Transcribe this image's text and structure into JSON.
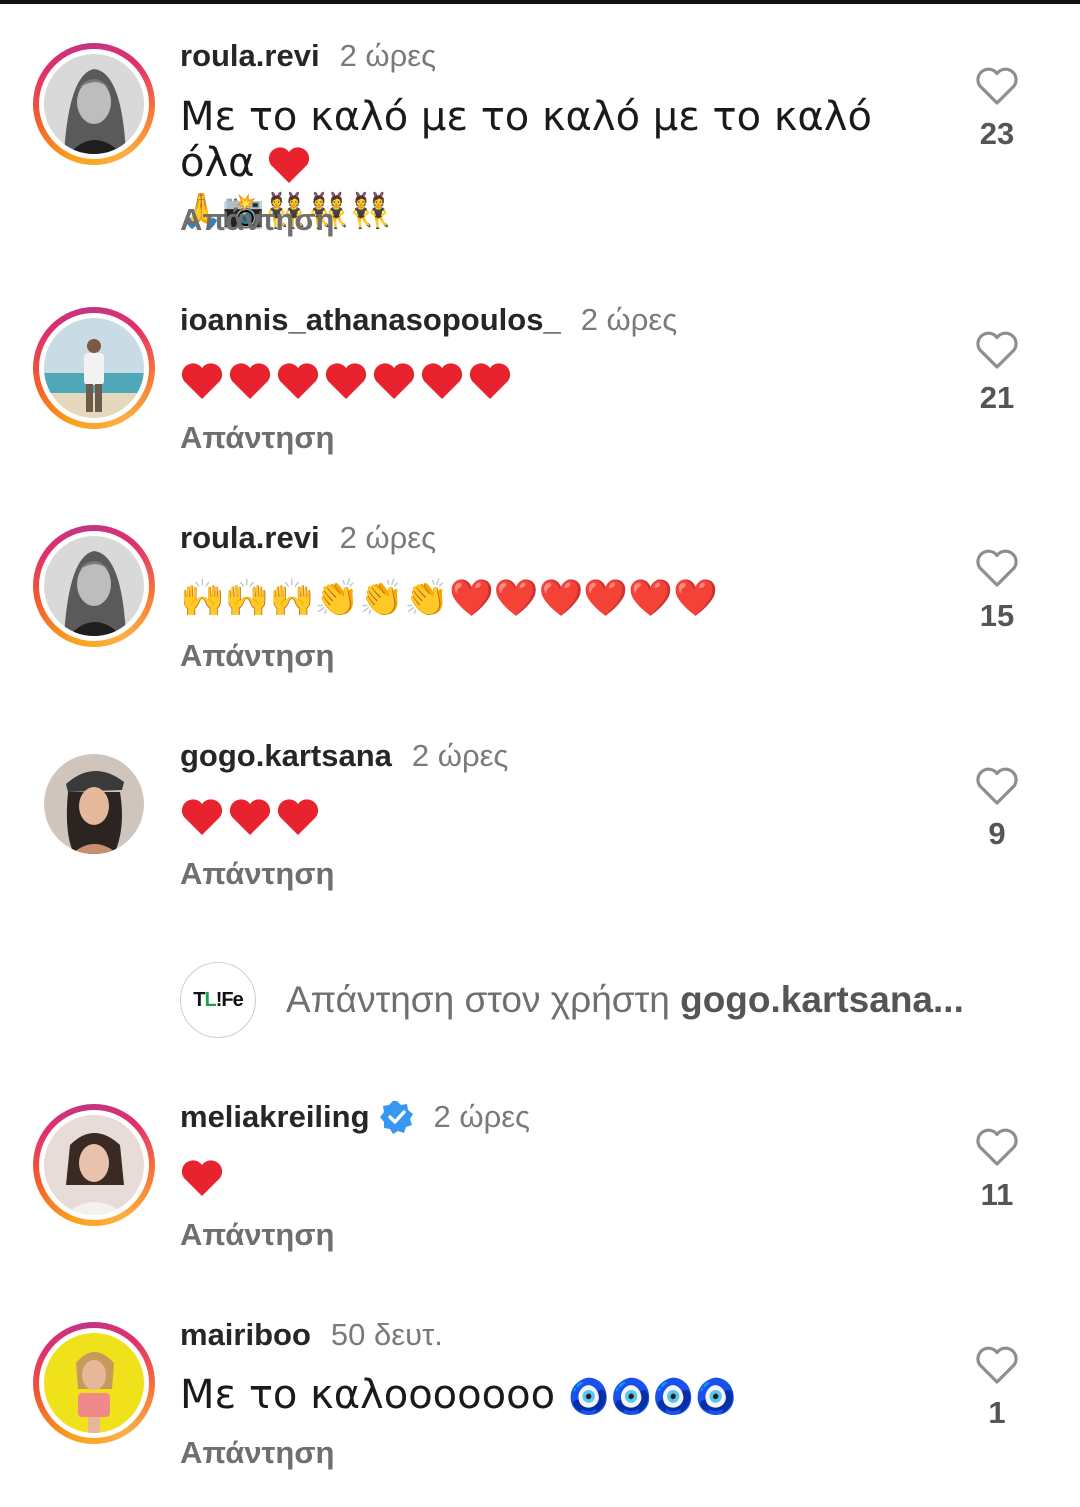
{
  "comments": [
    {
      "username": "roula.revi",
      "time": "2 ώρες",
      "text": "Με το καλό με το καλό με το καλό όλα",
      "emoji_line": "🙏📸👯👯👯",
      "reply_label": "Απάντηση",
      "likes": "23",
      "avatar": "woman-bw-portrait"
    },
    {
      "username": "ioannis_athanasopoulos_",
      "time": "2 ώρες",
      "emoji_line": "❤️❤️❤️❤️❤️❤️❤️",
      "reply_label": "Απάντηση",
      "likes": "21",
      "avatar": "man-on-beach"
    },
    {
      "username": "roula.revi",
      "time": "2 ώρες",
      "emoji_line": "🙌🙌🙌👏👏👏❤️❤️❤️❤️❤️❤️",
      "reply_label": "Απάντηση",
      "likes": "15",
      "avatar": "woman-bw-portrait"
    },
    {
      "username": "gogo.kartsana",
      "time": "2 ώρες",
      "emoji_line": "❤️❤️❤️",
      "reply_label": "Απάντηση",
      "likes": "9",
      "avatar": "woman-cap"
    },
    {
      "username": "meliakreiling",
      "verified": true,
      "time": "2 ώρες",
      "emoji_line": "❤️",
      "reply_label": "Απάντηση",
      "likes": "11",
      "avatar": "woman-dark-hair"
    },
    {
      "username": "mairiboo",
      "time": "50 δευτ.",
      "text": "Με το καλοοοοοοο",
      "emoji_line": "🧿🧿🧿🧿",
      "reply_label": "Απάντηση",
      "likes": "1",
      "avatar": "woman-yellow-bg"
    }
  ],
  "reply_box": {
    "prefix": "Απάντηση στον χρήστη",
    "target": "gogo.kartsana...",
    "logo_text": "TLIFE"
  },
  "colors": {
    "heart_red": "#e8232e",
    "verified_blue": "#3897f0",
    "muted_text": "#6f6f6f",
    "tlife_accent": "#1aa34a"
  },
  "icons": {
    "like": "heart-outline-icon",
    "verified": "verified-badge-icon"
  }
}
